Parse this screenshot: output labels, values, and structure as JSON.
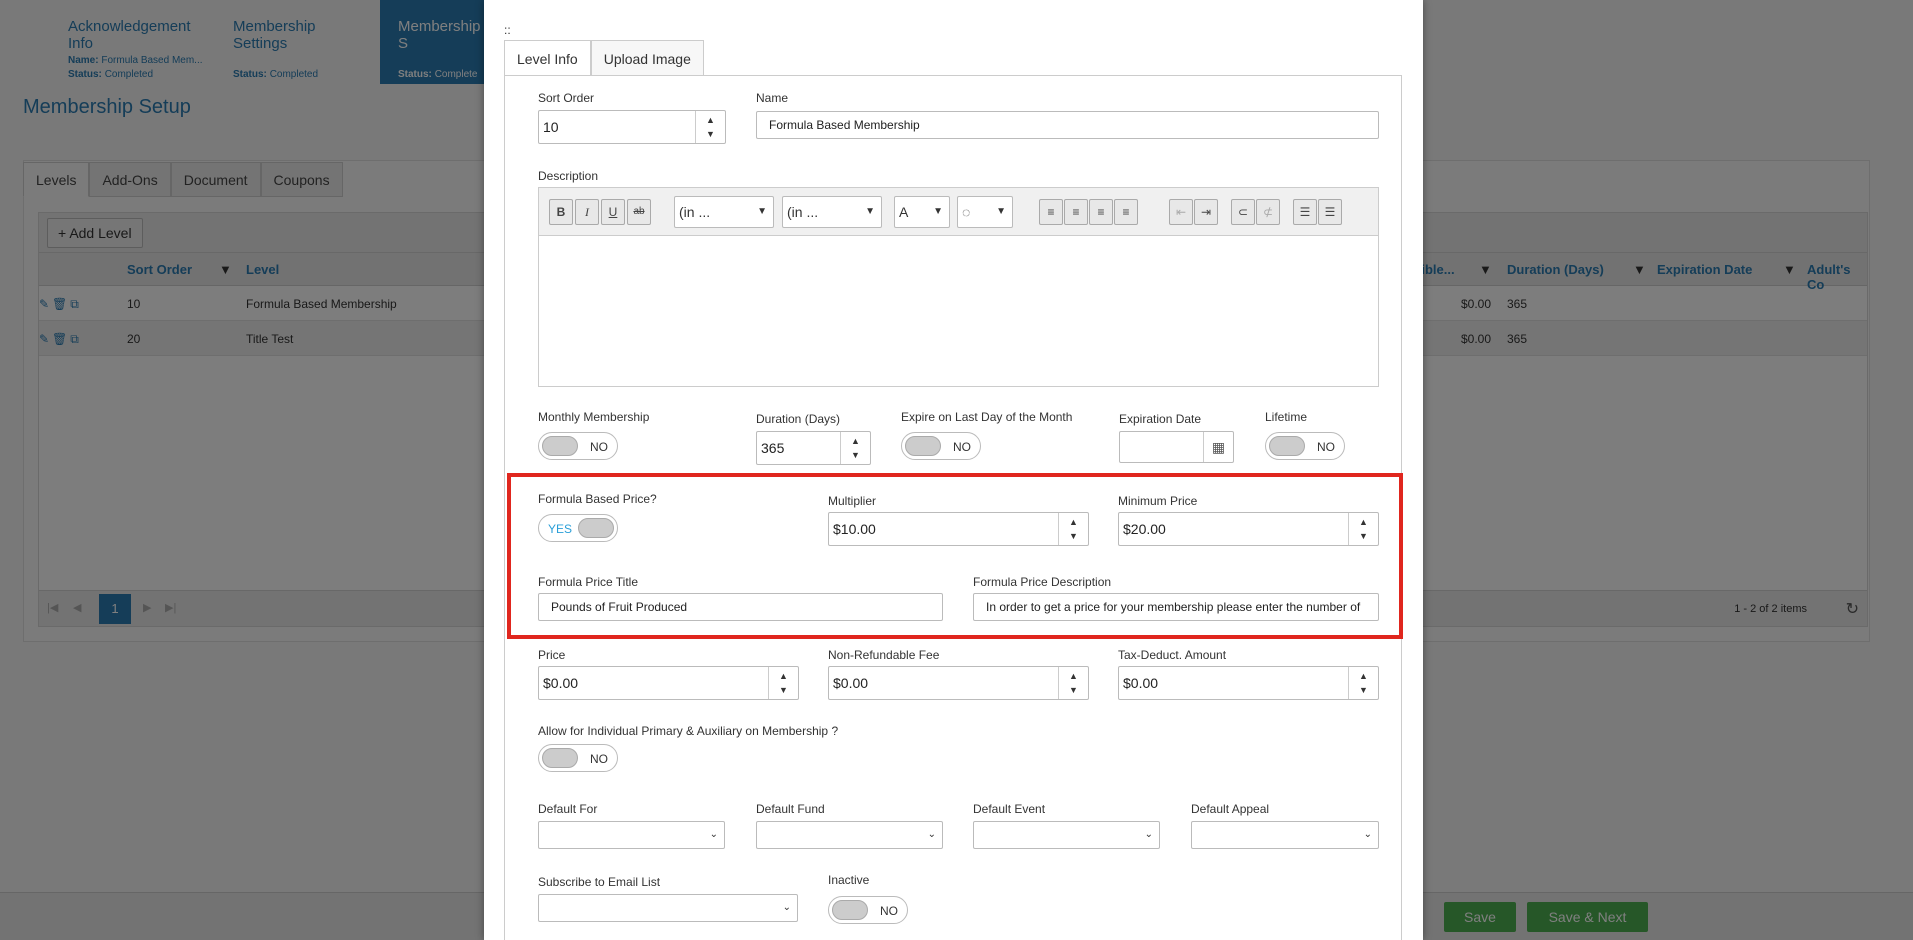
{
  "wizard": [
    {
      "title": "Acknowledgement Info",
      "name_label": "Name:",
      "name_value": "Formula Based Mem...",
      "status_label": "Status:",
      "status_value": "Completed"
    },
    {
      "title": "Membership Settings",
      "status_label": "Status:",
      "status_value": "Completed"
    },
    {
      "title": "Membership S",
      "status_label": "Status:",
      "status_value": "Complete"
    }
  ],
  "page_title": "Membership Setup",
  "bg_tabs": [
    "Levels",
    "Add-Ons",
    "Document",
    "Coupons"
  ],
  "add_level": "Add Level",
  "grid_headers": {
    "sort_order": "Sort Order",
    "level": "Level",
    "eligible": "tible...",
    "duration": "Duration (Days)",
    "expiration": "Expiration Date",
    "adults": "Adult's Co"
  },
  "grid_rows": [
    {
      "sort": "10",
      "level": "Formula Based Membership",
      "amount": "$0.00",
      "duration": "365"
    },
    {
      "sort": "20",
      "level": "Title Test",
      "amount": "$0.00",
      "duration": "365"
    }
  ],
  "pager": {
    "current": "1",
    "info": "1 - 2 of 2 items"
  },
  "footer": {
    "save": "Save",
    "save_next": "Save & Next"
  },
  "modal": {
    "drag_handle": "::",
    "tabs": [
      "Level Info",
      "Upload Image"
    ],
    "sort_order": {
      "label": "Sort Order",
      "value": "10"
    },
    "name": {
      "label": "Name",
      "value": "Formula Based Membership"
    },
    "description": {
      "label": "Description",
      "font_dd": "(in ...",
      "size_dd": "(in ...",
      "color_a": "A"
    },
    "monthly": {
      "label": "Monthly Membership",
      "state": "NO"
    },
    "duration": {
      "label": "Duration (Days)",
      "value": "365"
    },
    "expire_last": {
      "label": "Expire on Last Day of the Month",
      "state": "NO"
    },
    "expiration_date": {
      "label": "Expiration Date"
    },
    "lifetime": {
      "label": "Lifetime",
      "state": "NO"
    },
    "formula_price": {
      "label": "Formula Based Price?",
      "state": "YES"
    },
    "multiplier": {
      "label": "Multiplier",
      "value": "$10.00"
    },
    "minimum_price": {
      "label": "Minimum Price",
      "value": "$20.00"
    },
    "formula_title": {
      "label": "Formula Price Title",
      "value": "Pounds of Fruit Produced"
    },
    "formula_desc": {
      "label": "Formula Price Description",
      "value": "In order to get a price for your membership please enter the number of"
    },
    "price": {
      "label": "Price",
      "value": "$0.00"
    },
    "non_refundable": {
      "label": "Non-Refundable Fee",
      "value": "$0.00"
    },
    "tax_deduct": {
      "label": "Tax-Deduct. Amount",
      "value": "$0.00"
    },
    "allow_individual": {
      "label": "Allow for Individual Primary & Auxiliary on Membership ?",
      "state": "NO"
    },
    "default_for": {
      "label": "Default For"
    },
    "default_fund": {
      "label": "Default Fund"
    },
    "default_event": {
      "label": "Default Event"
    },
    "default_appeal": {
      "label": "Default Appeal"
    },
    "subscribe": {
      "label": "Subscribe to Email List"
    },
    "inactive": {
      "label": "Inactive",
      "state": "NO"
    }
  },
  "colors": {
    "accent": "#2a7ab0",
    "highlight": "#e0261e",
    "save_green": "#4caf50"
  }
}
